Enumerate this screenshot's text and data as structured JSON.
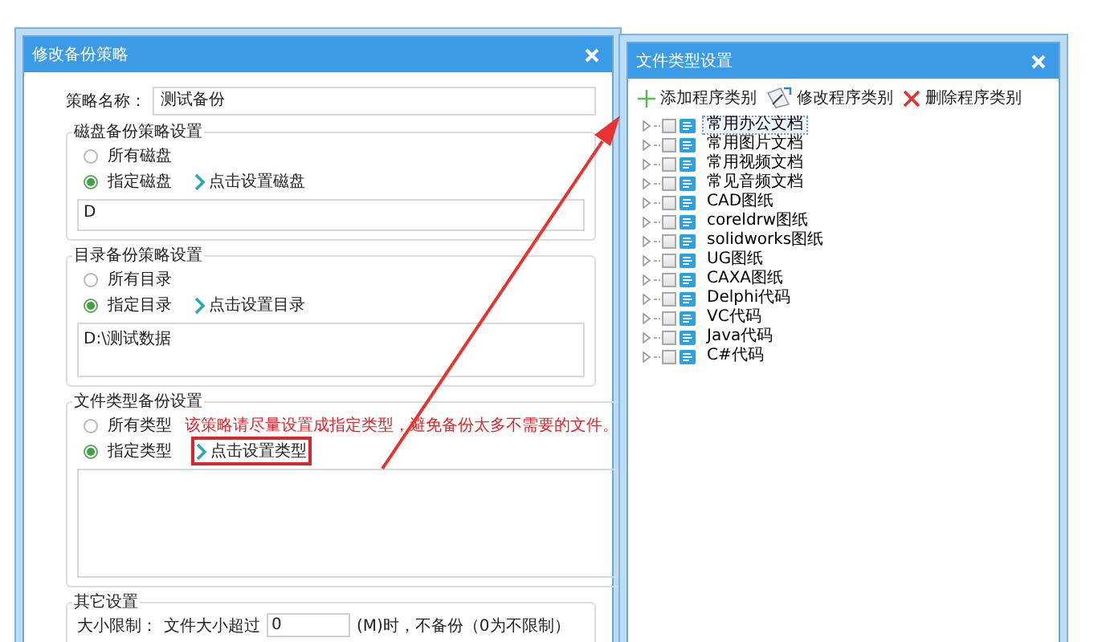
{
  "policy": {
    "title": "修改备份策略",
    "name_label": "策略名称：",
    "name_value": "测试备份",
    "groups": [
      {
        "title": "磁盘备份策略设置",
        "options": [
          {
            "label": "所有磁盘",
            "selected": false
          },
          {
            "label": "指定磁盘",
            "selected": true
          }
        ],
        "link": {
          "label": "点击设置磁盘",
          "highlighted": false
        },
        "list_value": "D"
      },
      {
        "title": "目录备份策略设置",
        "options": [
          {
            "label": "所有目录",
            "selected": false
          },
          {
            "label": "指定目录",
            "selected": true
          }
        ],
        "link": {
          "label": "点击设置目录",
          "highlighted": false
        },
        "list_value": "D:\\测试数据"
      },
      {
        "title": "文件类型备份设置",
        "options": [
          {
            "label": "所有类型",
            "selected": false,
            "note": "该策略请尽量设置成指定类型，避免备份太多不需要的文件。"
          },
          {
            "label": "指定类型",
            "selected": true
          }
        ],
        "link": {
          "label": "点击设置类型",
          "highlighted": true
        }
      }
    ],
    "other": {
      "title": "其它设置",
      "size_label": "大小限制：",
      "size_prefix": "文件大小超过",
      "size_value": "0",
      "size_suffix": "(M)时，不备份（0为不限制）"
    }
  },
  "types": {
    "title": "文件类型设置",
    "toolbar": [
      {
        "kind": "add",
        "label": "添加程序类别"
      },
      {
        "kind": "edit",
        "label": "修改程序类别"
      },
      {
        "kind": "delete",
        "label": "删除程序类别"
      }
    ],
    "tree": [
      {
        "label": "常用办公文档",
        "checked": false,
        "expanded": false,
        "selected": true
      },
      {
        "label": "常用图片文档",
        "checked": false,
        "expanded": false,
        "selected": false
      },
      {
        "label": "常用视频文档",
        "checked": false,
        "expanded": false,
        "selected": false
      },
      {
        "label": "常见音频文档",
        "checked": false,
        "expanded": false,
        "selected": false
      },
      {
        "label": "CAD图纸",
        "checked": false,
        "expanded": false,
        "selected": false
      },
      {
        "label": "coreldrw图纸",
        "checked": false,
        "expanded": false,
        "selected": false
      },
      {
        "label": "solidworks图纸",
        "checked": false,
        "expanded": false,
        "selected": false
      },
      {
        "label": "UG图纸",
        "checked": false,
        "expanded": false,
        "selected": false
      },
      {
        "label": "CAXA图纸",
        "checked": false,
        "expanded": false,
        "selected": false
      },
      {
        "label": "Delphi代码",
        "checked": false,
        "expanded": false,
        "selected": false
      },
      {
        "label": "VC代码",
        "checked": false,
        "expanded": false,
        "selected": false
      },
      {
        "label": "Java代码",
        "checked": false,
        "expanded": false,
        "selected": false
      },
      {
        "label": "C#代码",
        "checked": false,
        "expanded": false,
        "selected": false
      }
    ]
  }
}
